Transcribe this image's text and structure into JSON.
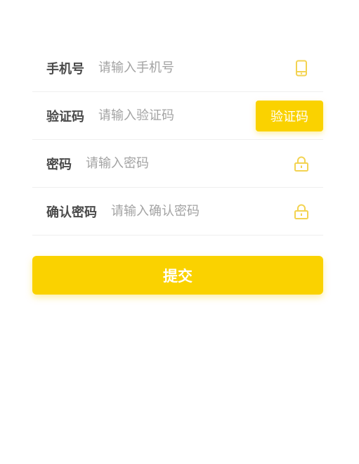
{
  "colors": {
    "accent": "#fad200",
    "label": "#4a4a4a",
    "placeholder": "#a3a3a3",
    "divider": "#efefef",
    "icon": "#f3d351"
  },
  "form": {
    "phone": {
      "label": "手机号",
      "placeholder": "请输入手机号",
      "value": "",
      "icon": "phone-icon"
    },
    "code": {
      "label": "验证码",
      "placeholder": "请输入验证码",
      "value": "",
      "button_label": "验证码"
    },
    "password": {
      "label": "密码",
      "placeholder": "请输入密码",
      "value": "",
      "icon": "lock-icon"
    },
    "confirm_password": {
      "label": "确认密码",
      "placeholder": "请输入确认密码",
      "value": "",
      "icon": "lock-icon"
    }
  },
  "actions": {
    "submit_label": "提交"
  }
}
